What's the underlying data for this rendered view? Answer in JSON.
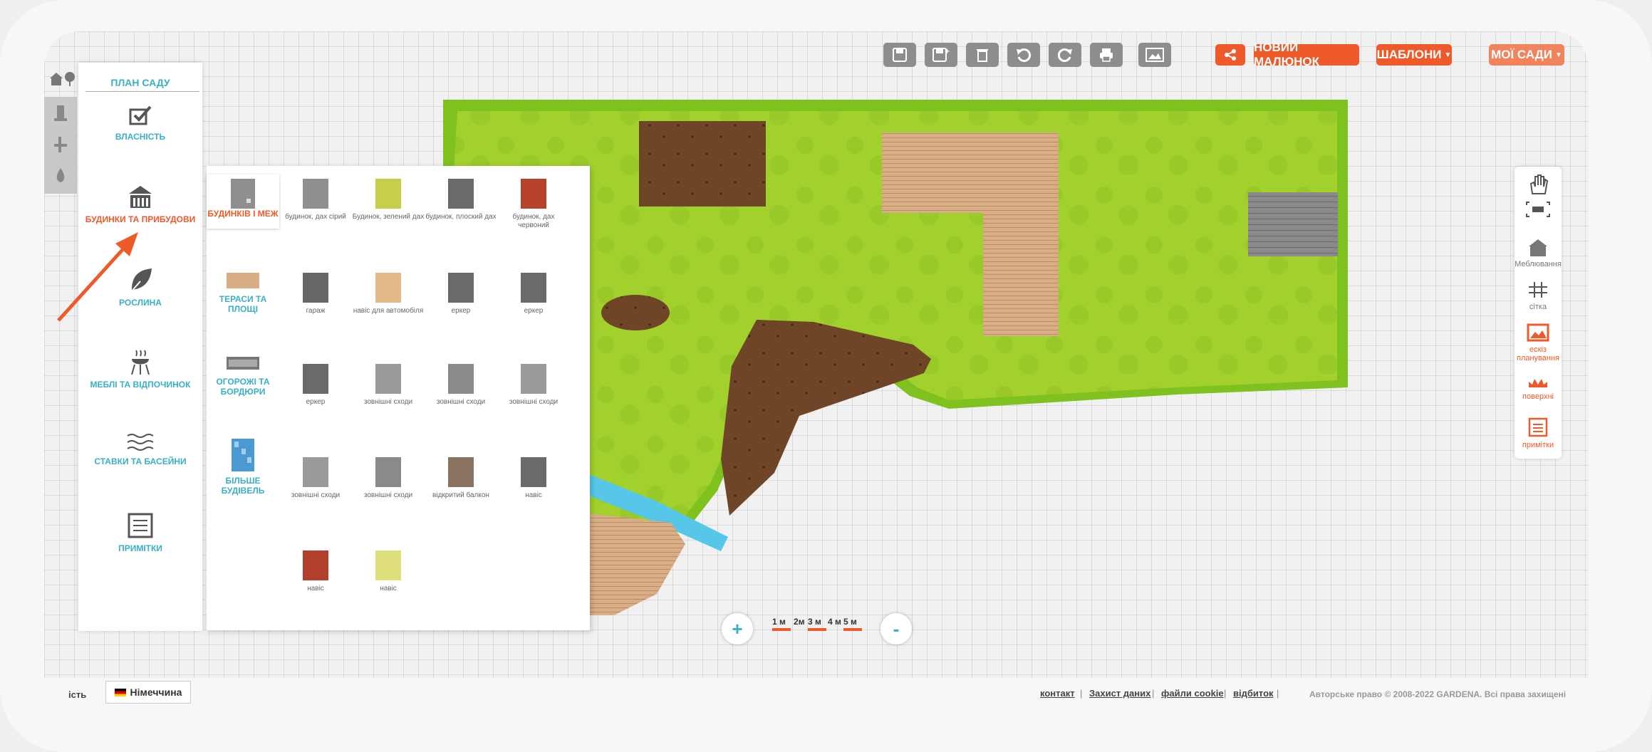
{
  "header": {
    "share_icon": "share-icon",
    "new_drawing": "НОВИЙ МАЛЮНОК",
    "templates": "ШАБЛОНИ",
    "my_gardens": "МОЇ САДИ",
    "toolbar_icons": [
      "save-icon",
      "save-as-icon",
      "delete-icon",
      "undo-icon",
      "redo-icon",
      "print-icon",
      "image-icon"
    ]
  },
  "left": {
    "title": "ПЛАН САДУ",
    "categories": [
      {
        "label": "ВЛАСНІСТЬ",
        "icon": "property-icon"
      },
      {
        "label": "БУДИНКИ ТА ПРИБУДОВИ",
        "icon": "house-icon",
        "active": true
      },
      {
        "label": "РОСЛИНА",
        "icon": "leaf-icon"
      },
      {
        "label": "МЕБЛІ ТА ВІДПОЧИНОК",
        "icon": "grill-icon"
      },
      {
        "label": "СТАВКИ ТА БАСЕЙНИ",
        "icon": "water-icon"
      },
      {
        "label": "ПРИМІТКИ",
        "icon": "notes-icon"
      }
    ]
  },
  "sub": {
    "categories": [
      {
        "label": "БУДИНКІВ І МЕЖ",
        "active": true
      },
      {
        "label": "ТЕРАСИ ТА ПЛОЩІ"
      },
      {
        "label": "ОГОРОЖІ ТА БОРДЮРИ"
      },
      {
        "label": "БІЛЬШЕ БУДІВЕЛЬ"
      }
    ],
    "items": [
      {
        "label": "будинок, дах сірий",
        "color": "#8f8f8f"
      },
      {
        "label": "Будинок, зелений дах",
        "color": "#c6cf4a"
      },
      {
        "label": "будинок, плоский дах",
        "color": "#6a6a6a"
      },
      {
        "label": "будинок, дах червоний",
        "color": "#b6422c"
      },
      {
        "label": "гараж",
        "color": "#666666"
      },
      {
        "label": "навіс для автомобіля",
        "color": "#e4b98a"
      },
      {
        "label": "еркер",
        "color": "#6a6a6a"
      },
      {
        "label": "еркер",
        "color": "#6a6a6a"
      },
      {
        "label": "еркер",
        "color": "#6a6a6a"
      },
      {
        "label": "зовнішні сходи",
        "color": "#9a9a9a"
      },
      {
        "label": "зовнішні сходи",
        "color": "#8a8a8a"
      },
      {
        "label": "зовнішні сходи",
        "color": "#9a9a9a"
      },
      {
        "label": "зовнішні сходи",
        "color": "#9a9a9a"
      },
      {
        "label": "зовнішні сходи",
        "color": "#8a8a8a"
      },
      {
        "label": "відкритий балкон",
        "color": "#8a7260"
      },
      {
        "label": "навіс",
        "color": "#6a6a6a"
      },
      {
        "label": "навіс",
        "color": "#b3402c"
      },
      {
        "label": "навіс",
        "color": "#dede7a"
      }
    ]
  },
  "right": {
    "tools": [
      {
        "label": "",
        "icon": "hand-icon"
      },
      {
        "label": "",
        "icon": "fit-screen-icon"
      },
      {
        "label": "Меблювання",
        "icon": "furnish-icon"
      },
      {
        "label": "сітка",
        "icon": "grid-icon"
      },
      {
        "label": "ескіз планування",
        "icon": "sketch-icon",
        "accent": true
      },
      {
        "label": "поверхні",
        "icon": "surfaces-icon",
        "accent": true
      },
      {
        "label": "примітки",
        "icon": "notes-icon",
        "accent": true
      }
    ]
  },
  "zoom": {
    "plus": "+",
    "minus": "-"
  },
  "scale": [
    "1 м",
    "2м",
    "3 м",
    "4 м",
    "5 м"
  ],
  "footer": {
    "left_text": "ість",
    "country": "Німеччина",
    "links": [
      "контакт",
      "Захист даних",
      "файли cookie",
      "відбиток"
    ],
    "copyright": "Авторське право © 2008-2022 GARDENA. Всі права захищені"
  },
  "colors": {
    "accent": "#ee5a2a",
    "teal": "#3aafc5",
    "lawn": "#a4d22e",
    "soil": "#6e4526",
    "water": "#56c7e8"
  }
}
